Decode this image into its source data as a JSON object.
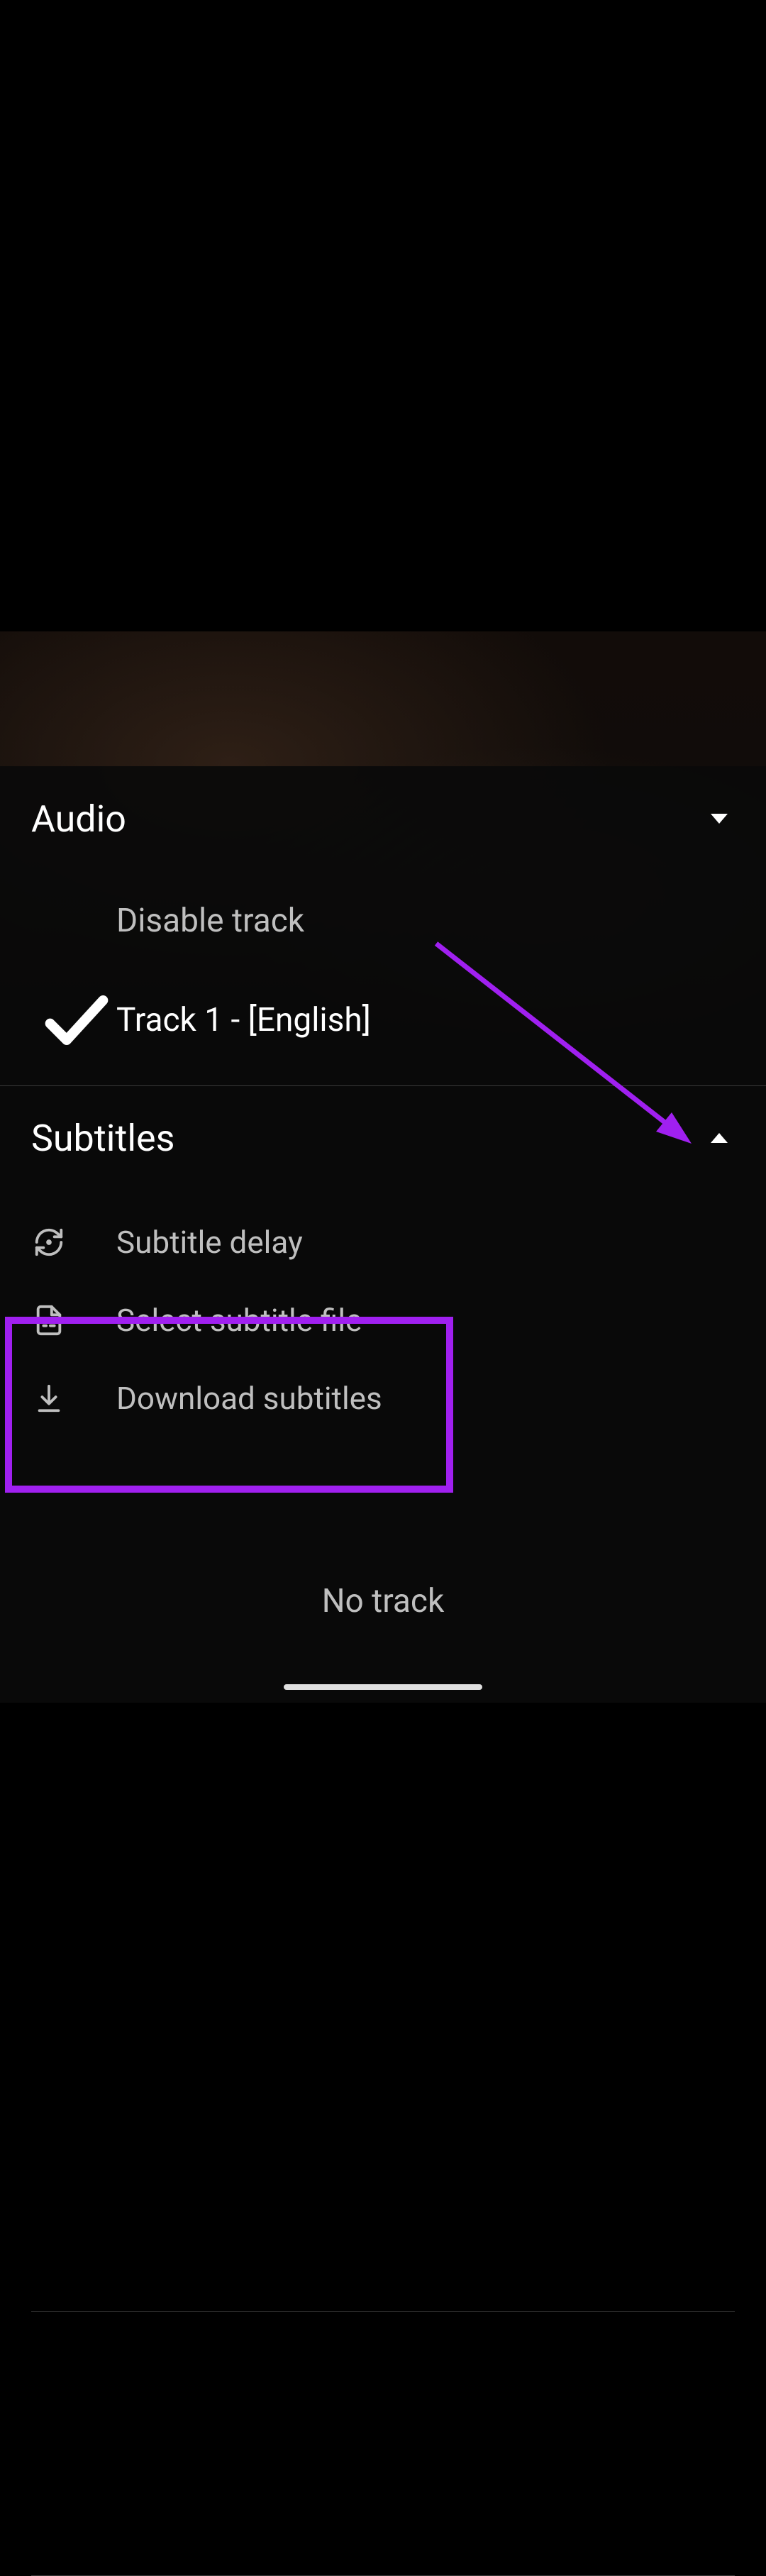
{
  "audio": {
    "title": "Audio",
    "disable_label": "Disable track",
    "tracks": [
      {
        "label": "Track 1 - [English]",
        "selected": true
      }
    ]
  },
  "subtitles": {
    "title": "Subtitles",
    "actions": {
      "delay": "Subtitle delay",
      "select": "Select subtitle file",
      "download": "Download subtitles"
    },
    "no_track": "No track"
  },
  "colors": {
    "annotation": "#a020f0"
  }
}
